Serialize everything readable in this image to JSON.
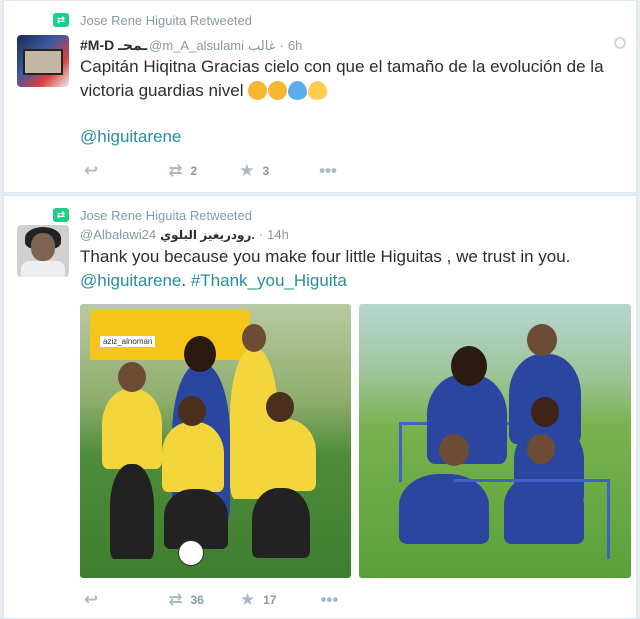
{
  "tweets": [
    {
      "retweeted_by": "Jose Rene Higuita Retweeted",
      "display_name": "#M-D ـمحـ",
      "handle": "@m_A_alsulami",
      "handle_suffix": "غالب",
      "time": "6h",
      "text": "Capitán Hiqitna Gracias cielo con que el tamaño de la evolución de la victoria guardias nivel",
      "emojis": [
        "kissing-face-icon",
        "kissing-face-icon",
        "blue-heart-icon",
        "yellow-heart-icon"
      ],
      "mention": "@higuitarene",
      "retweet_count": "2",
      "like_count": "3"
    },
    {
      "retweeted_by": "Jose Rene Higuita Retweeted",
      "display_name": "رودريغيز البلوي.",
      "handle": "@Albalawi24",
      "time": "14h",
      "text": "Thank you because you make four little Higuitas , we trust in you.",
      "mention": "@higuitarene",
      "hashtag": "#Thank_you_Higuita",
      "photo_tag": "aziz_alnoman",
      "retweet_count": "36",
      "like_count": "17"
    }
  ],
  "colors": {
    "link": "#2a8ea0",
    "retweet_green": "#19cf86",
    "muted": "#8899a6"
  }
}
